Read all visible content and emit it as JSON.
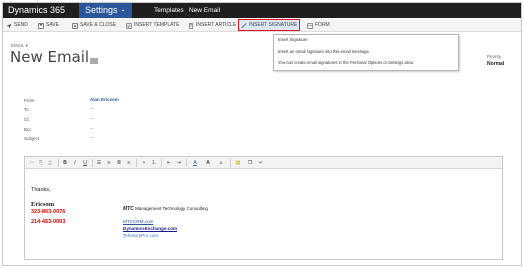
{
  "nav": {
    "brand": "Dynamics 365",
    "settings": "Settings",
    "caret": "⌄",
    "crumbs": [
      "Templates",
      "New Email"
    ]
  },
  "commands": [
    {
      "label": "SEND",
      "icon": "send-icon"
    },
    {
      "label": "SAVE",
      "icon": "save-icon"
    },
    {
      "label": "SAVE & CLOSE",
      "icon": "save-close-icon"
    },
    {
      "label": "INSERT TEMPLATE",
      "icon": "template-icon"
    },
    {
      "label": "INSERT ARTICLE",
      "icon": "article-icon"
    },
    {
      "label": "INSERT SIGNATURE",
      "icon": "signature-icon",
      "highlighted": true
    },
    {
      "label": "FORM",
      "icon": "form-icon"
    }
  ],
  "tooltip": {
    "title": "Insert Signature",
    "line1": "Insert an email signature into this email message.",
    "line2": "You can create email signatures in the Personal Options or Settings area."
  },
  "header": {
    "record_type": "EMAIL ▾",
    "title": "New Email",
    "priority_label": "Priority",
    "priority_value": "Normal"
  },
  "fields": [
    {
      "label": "From",
      "value": "Alan Ericsom"
    },
    {
      "label": "To",
      "value": "--"
    },
    {
      "label": "Cc",
      "value": "--"
    },
    {
      "label": "Bcc",
      "value": "--"
    },
    {
      "label": "Subject",
      "value": "--"
    }
  ],
  "editor": {
    "toolbar": [
      "✂",
      "⎘",
      "⎙",
      "B",
      "I",
      "U",
      "☰",
      "≡",
      "≣",
      "≡",
      "•",
      "1.",
      "⇤",
      "⇥",
      "A",
      "A",
      "A",
      "▨",
      "❐",
      "↵"
    ],
    "greeting": "Thanks,",
    "signature": {
      "name": "Ericsom",
      "phones": [
        "323-863-0076",
        "214-453-0093"
      ],
      "company_abbr": "MTC",
      "company_full": "Management Technology Consulting",
      "links": [
        "MTCCRM.com",
        "DynamicsExchange.com",
        "TeleSerpPro.com"
      ]
    }
  },
  "colors": {
    "nav_bg": "#1f1f1f",
    "settings_bg": "#2b579a",
    "highlight_border": "#e81123",
    "phone_red": "#e00000",
    "link_blue": "#2b579a"
  }
}
